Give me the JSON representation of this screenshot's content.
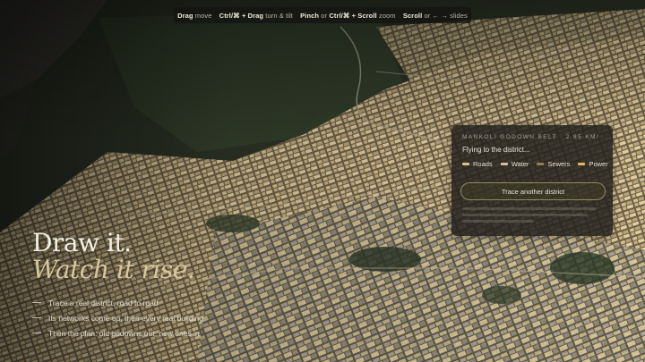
{
  "hints": [
    {
      "keys": "Drag",
      "action": "move"
    },
    {
      "keys": "Ctrl/⌘ + Drag",
      "action": "turn & tilt"
    },
    {
      "keys": "Pinch",
      "mid": "or",
      "keys2": "Ctrl/⌘ + Scroll",
      "action": "zoom"
    },
    {
      "keys": "Scroll",
      "mid": "or",
      "keys2": "← →",
      "action": "slides"
    }
  ],
  "headline": {
    "line1": "Draw it.",
    "line2": "Watch it rise."
  },
  "bullets": [
    "Trace a real district, road to road",
    "Its networks come up, then every real building",
    "Then the plan: old godowns out, new ones in"
  ],
  "panel": {
    "title": "MANKOLI GODOWN BELT · 2.85 KM²",
    "status": "Flying to the district...",
    "legend": [
      {
        "label": "Roads",
        "color": "#d8c58e"
      },
      {
        "label": "Water",
        "color": "#cfc4a0"
      },
      {
        "label": "Sewers",
        "color": "#9c7a56"
      },
      {
        "label": "Power",
        "color": "#e9b75a"
      }
    ],
    "button_label": "Trace another district"
  },
  "colors": {
    "accent": "#d7c89c",
    "panel_bg": "#24221e"
  }
}
